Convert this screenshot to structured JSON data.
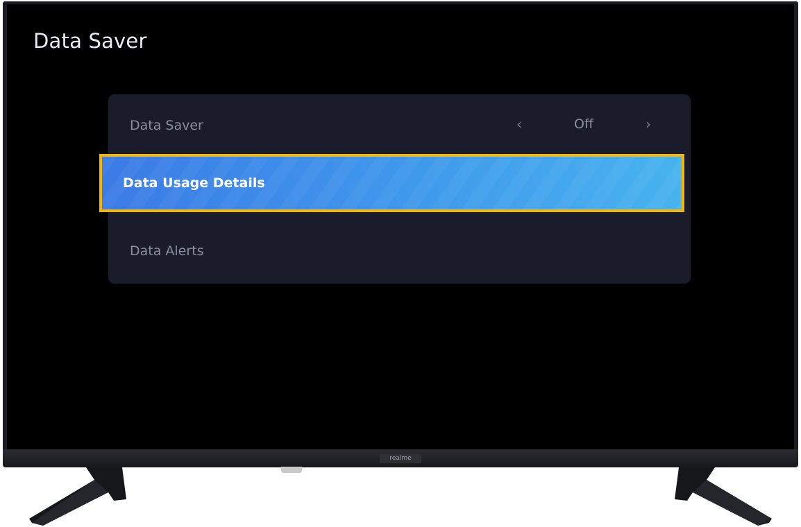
{
  "screen": {
    "title": "Data Saver"
  },
  "settings": {
    "items": [
      {
        "label": "Data Saver",
        "value": "Off",
        "state": "normal"
      },
      {
        "label": "Data Usage Details",
        "state": "focused"
      },
      {
        "label": "Data Alerts",
        "state": "normal"
      }
    ]
  },
  "device": {
    "brand": "realme"
  },
  "colors": {
    "focus_border": "#f3b712",
    "focus_gradient_start": "#3b7be6",
    "focus_gradient_end": "#48b3ef",
    "panel_background": "#1b1c2b",
    "screen_background": "#000000"
  },
  "icons": {
    "prev": "chevron-left-icon",
    "next": "chevron-right-icon"
  }
}
